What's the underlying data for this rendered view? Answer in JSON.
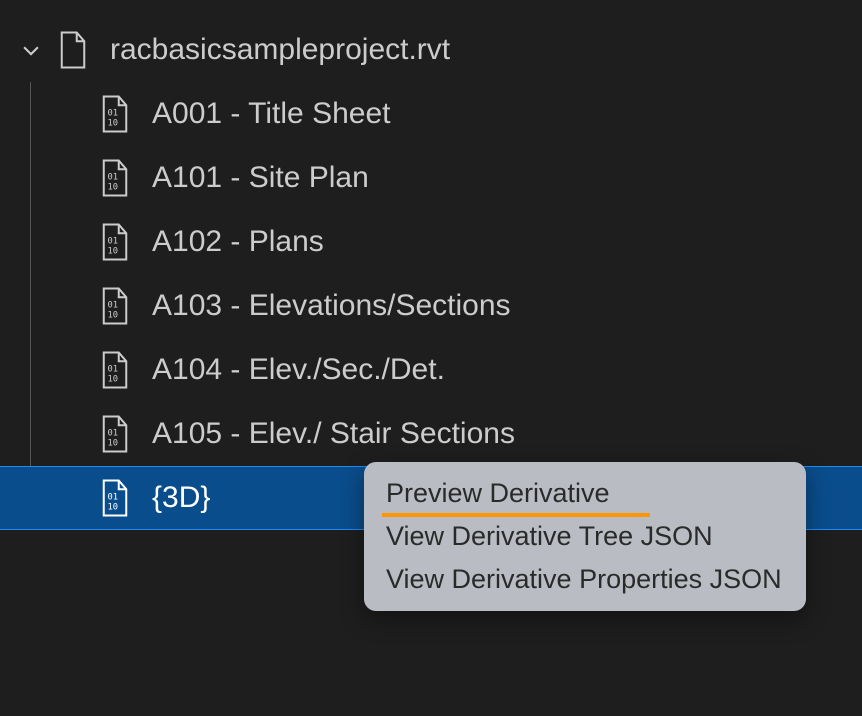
{
  "root": {
    "label": "racbasicsampleproject.rvt"
  },
  "children": [
    {
      "label": "A001 - Title Sheet"
    },
    {
      "label": "A101 - Site Plan"
    },
    {
      "label": "A102 - Plans"
    },
    {
      "label": "A103 - Elevations/Sections"
    },
    {
      "label": "A104 - Elev./Sec./Det."
    },
    {
      "label": "A105 - Elev./ Stair Sections"
    },
    {
      "label": "{3D}"
    }
  ],
  "contextMenu": {
    "items": [
      "Preview Derivative",
      "View Derivative Tree JSON",
      "View Derivative Properties JSON"
    ]
  }
}
